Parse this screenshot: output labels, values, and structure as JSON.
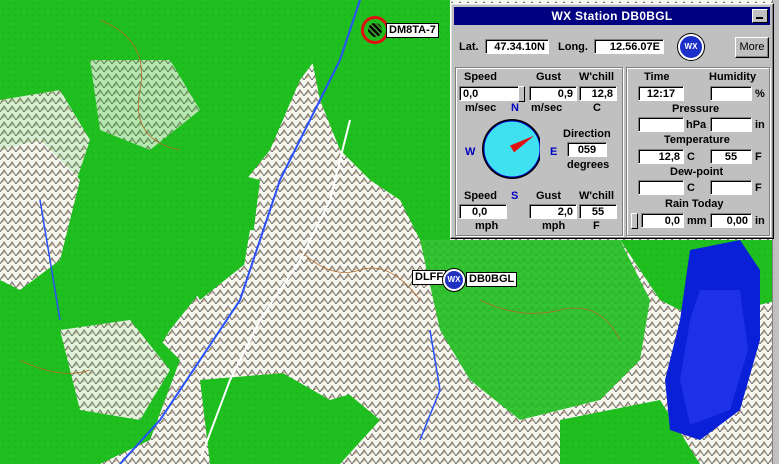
{
  "map": {
    "markers": {
      "dm8ta": {
        "label": "DM8TA-7"
      },
      "dlff": {
        "label": "DLFF"
      },
      "db0bgl": {
        "label": "DB0BGL",
        "badge": "WX"
      }
    },
    "colors": {
      "forest": "#1fbf1f",
      "rock": "#f4f4ec",
      "lake": "#0a1fd8",
      "river": "#2850ff",
      "contour": "#b06a2a",
      "marker_ring": "#e01010"
    }
  },
  "wx_window": {
    "title": "WX Station  DB0BGL",
    "lat_label": "Lat.",
    "lat_value": "47.34.10N",
    "long_label": "Long.",
    "long_value": "12.56.07E",
    "icon": "WX",
    "more_label": "More",
    "metric": {
      "speed_label": "Speed",
      "speed_value": "0,0",
      "speed_unit": "m/sec",
      "gust_label": "Gust",
      "gust_value": "0,9",
      "gust_unit": "m/sec",
      "chill_label": "W'chill",
      "chill_value": "12,8",
      "chill_unit": "C"
    },
    "compass": {
      "n": "N",
      "s": "S",
      "w": "W",
      "e": "E",
      "direction_degrees": 59
    },
    "direction": {
      "label": "Direction",
      "value": "059",
      "unit": "degrees"
    },
    "imperial": {
      "speed_label": "Speed",
      "speed_value": "0,0",
      "speed_unit": "mph",
      "gust_label": "Gust",
      "gust_value": "2,0",
      "gust_unit": "mph",
      "chill_label": "W'chill",
      "chill_value": "55",
      "chill_unit": "F"
    },
    "time": {
      "label": "Time",
      "value": "12:17"
    },
    "humidity": {
      "label": "Humidity",
      "value": "",
      "unit": "%"
    },
    "pressure": {
      "label": "Pressure",
      "hpa_value": "",
      "hpa_unit": "hPa",
      "in_value": "",
      "in_unit": "in"
    },
    "temperature": {
      "label": "Temperature",
      "c_value": "12,8",
      "c_unit": "C",
      "f_value": "55",
      "f_unit": "F"
    },
    "dewpoint": {
      "label": "Dew-point",
      "c_value": "",
      "c_unit": "C",
      "f_value": "",
      "f_unit": "F"
    },
    "rain": {
      "label": "Rain Today",
      "mm_value": "0,0",
      "mm_unit": "mm",
      "in_value": "0,00",
      "in_unit": "in"
    }
  }
}
